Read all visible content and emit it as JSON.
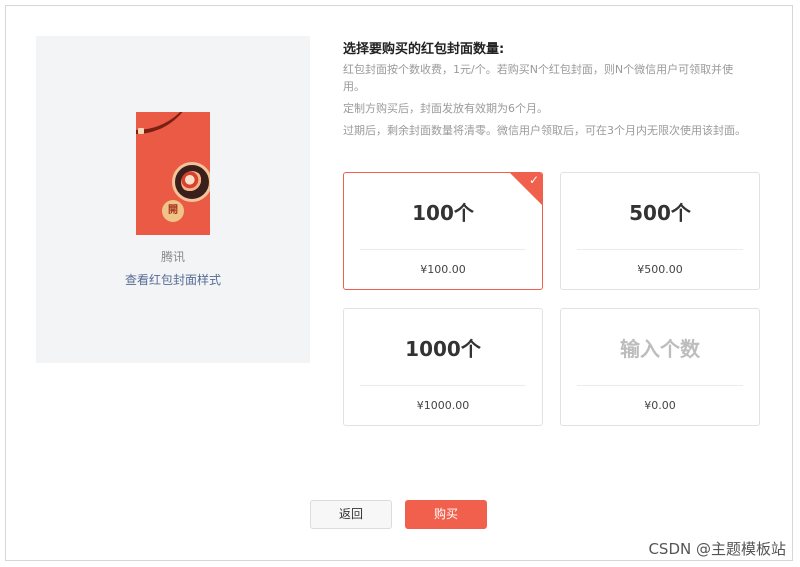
{
  "preview": {
    "cover_button_label": "開",
    "brand_name": "腾讯",
    "style_link": "查看红包封面样式"
  },
  "purchase": {
    "title": "选择要购买的红包封面数量:",
    "desc": [
      "红包封面按个数收费，1元/个。若购买N个红包封面，则N个微信用户可领取并使用。",
      "定制方购买后，封面发放有效期为6个月。",
      "过期后，剩余封面数量将清零。微信用户领取后，可在3个月内无限次使用该封面。"
    ],
    "options": [
      {
        "qty": "100个",
        "price": "¥100.00",
        "selected": true
      },
      {
        "qty": "500个",
        "price": "¥500.00",
        "selected": false
      },
      {
        "qty": "1000个",
        "price": "¥1000.00",
        "selected": false
      },
      {
        "qty": "输入个数",
        "price": "¥0.00",
        "selected": false
      }
    ],
    "selected_color": "#f0604c"
  },
  "actions": {
    "back_label": "返回",
    "buy_label": "购买"
  },
  "watermark": "CSDN @主题模板站",
  "icons": {
    "check": "check-icon"
  }
}
